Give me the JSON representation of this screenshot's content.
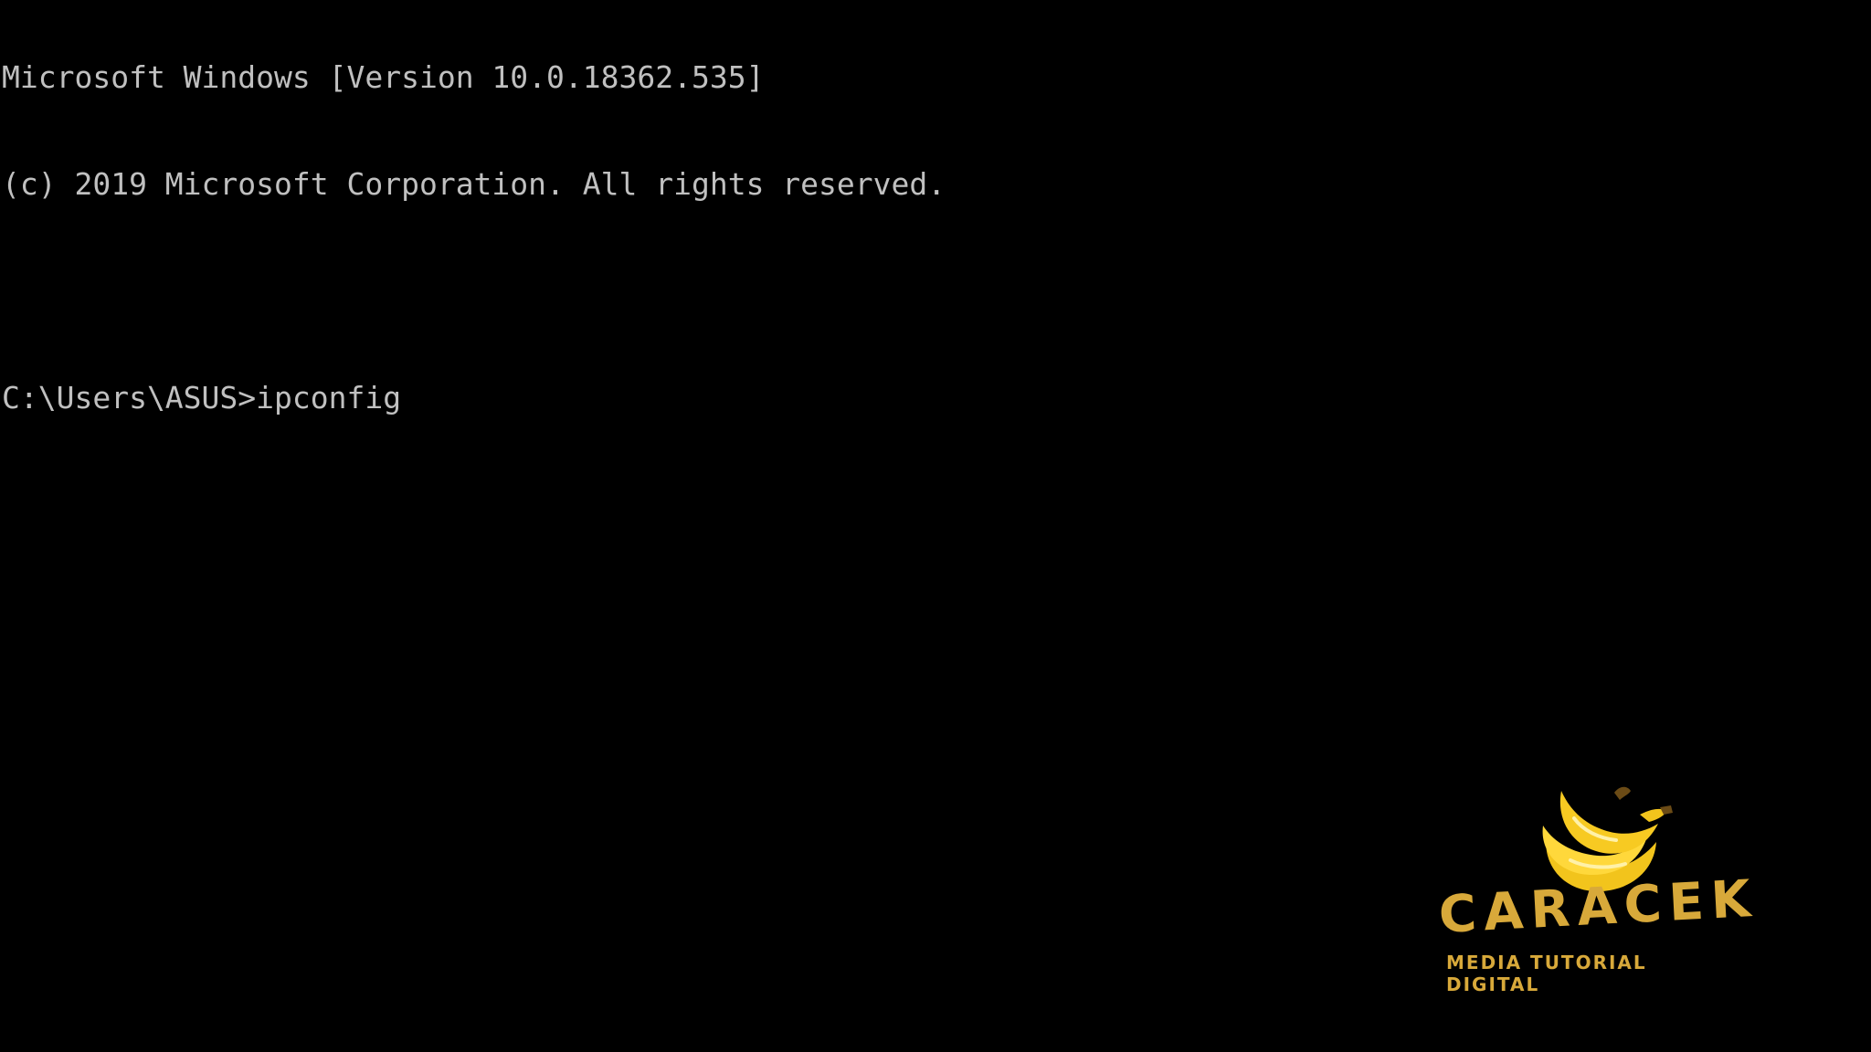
{
  "console": {
    "lines": [
      "Microsoft Windows [Version 10.0.18362.535]",
      "(c) 2019 Microsoft Corporation. All rights reserved.",
      ""
    ],
    "prompt": "C:\\Users\\ASUS>",
    "command": "ipconfig",
    "text_color": "#c0c0c0",
    "background_color": "#000000"
  },
  "watermark": {
    "brand": "CARACEK",
    "tagline": "MEDIA TUTORIAL DIGITAL",
    "icon": "banana-icon",
    "color": "#d8a93a"
  }
}
